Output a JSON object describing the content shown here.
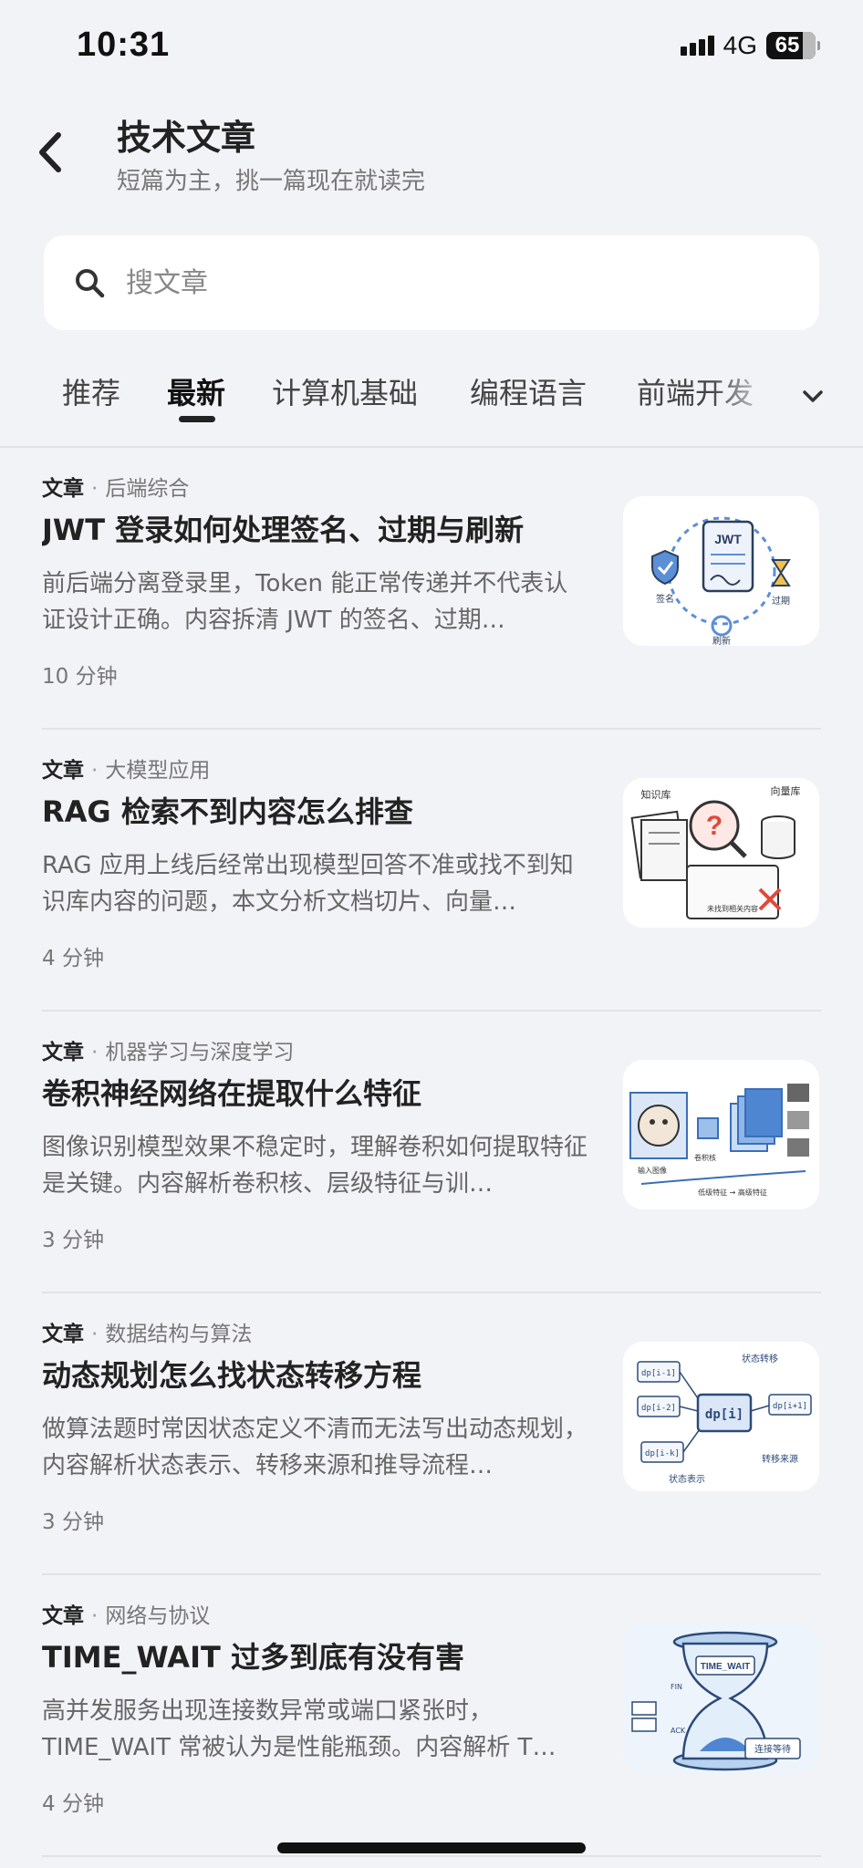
{
  "status_bar": {
    "time": "10:31",
    "network": "4G",
    "battery": "65"
  },
  "header": {
    "title": "技术文章",
    "subtitle": "短篇为主，挑一篇现在就读完"
  },
  "search": {
    "placeholder": "搜文章"
  },
  "tabs": [
    {
      "label": "推荐",
      "active": false
    },
    {
      "label": "最新",
      "active": true
    },
    {
      "label": "计算机基础",
      "active": false
    },
    {
      "label": "编程语言",
      "active": false
    },
    {
      "label": "前端开发",
      "active": false
    }
  ],
  "articles": [
    {
      "kind": "文章",
      "category": "后端综合",
      "title": "JWT 登录如何处理签名、过期与刷新",
      "description": "前后端分离登录里，Token 能正常传递并不代表认证设计正确。内容拆清 JWT 的签名、过期…",
      "read_time": "10 分钟",
      "thumb": {
        "labels": [
          "JWT",
          "签名",
          "过期",
          "刷新"
        ]
      }
    },
    {
      "kind": "文章",
      "category": "大模型应用",
      "title": "RAG 检索不到内容怎么排查",
      "description": "RAG 应用上线后经常出现模型回答不准或找不到知识库内容的问题，本文分析文档切片、向量…",
      "read_time": "4 分钟",
      "thumb": {
        "labels": [
          "知识库",
          "向量库",
          "未找到相关内容"
        ]
      }
    },
    {
      "kind": "文章",
      "category": "机器学习与深度学习",
      "title": "卷积神经网络在提取什么特征",
      "description": "图像识别模型效果不稳定时，理解卷积如何提取特征是关键。内容解析卷积核、层级特征与训…",
      "read_time": "3 分钟",
      "thumb": {
        "labels": [
          "输入图像",
          "卷积核",
          "低级特征 → 高级特征"
        ]
      }
    },
    {
      "kind": "文章",
      "category": "数据结构与算法",
      "title": "动态规划怎么找状态转移方程",
      "description": "做算法题时常因状态定义不清而无法写出动态规划，内容解析状态表示、转移来源和推导流程…",
      "read_time": "3 分钟",
      "thumb": {
        "labels": [
          "dp[i]",
          "dp[i-1]",
          "dp[i-2]",
          "dp[i-k]",
          "dp[i+1]",
          "状态转移",
          "状态表示",
          "转移来源"
        ]
      }
    },
    {
      "kind": "文章",
      "category": "网络与协议",
      "title": "TIME_WAIT 过多到底有没有害",
      "description": "高并发服务出现连接数异常或端口紧张时，TIME_WAIT 常被认为是性能瓶颈。内容解析 T…",
      "read_time": "4 分钟",
      "thumb": {
        "labels": [
          "TIME_WAIT",
          "FIN",
          "ACK",
          "连接等待"
        ]
      }
    }
  ]
}
